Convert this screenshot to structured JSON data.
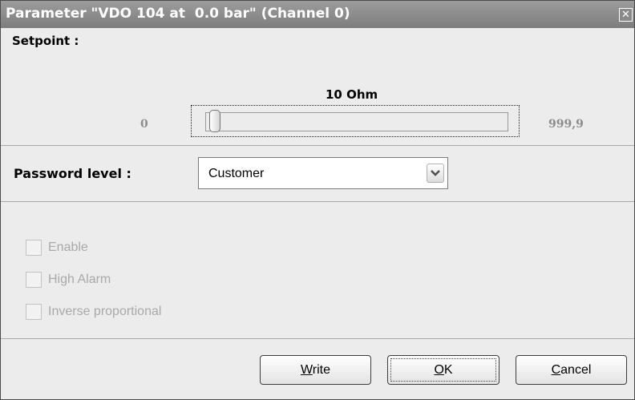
{
  "window": {
    "title": "Parameter \"VDO 104 at  0.0 bar\" (Channel 0)",
    "close_glyph": "✕"
  },
  "setpoint": {
    "label": "Setpoint :",
    "value_text": "10 Ohm",
    "min_label": "0",
    "max_label": "999,9",
    "slider_fraction": 0.01
  },
  "password": {
    "label": "Password level :",
    "selected": "Customer"
  },
  "options": [
    {
      "label": "Enable",
      "checked": false,
      "enabled": false
    },
    {
      "label": "High Alarm",
      "checked": false,
      "enabled": false
    },
    {
      "label": "Inverse proportional",
      "checked": false,
      "enabled": false
    }
  ],
  "buttons": {
    "write": {
      "mnemonic": "W",
      "rest": "rite"
    },
    "ok": {
      "mnemonic": "O",
      "rest": "K"
    },
    "cancel": {
      "mnemonic": "C",
      "rest": "ancel"
    }
  },
  "colors": {
    "titlebar": "#8d8d8d",
    "dialog_bg": "#ececec",
    "disabled_text": "#a9a9a9"
  }
}
